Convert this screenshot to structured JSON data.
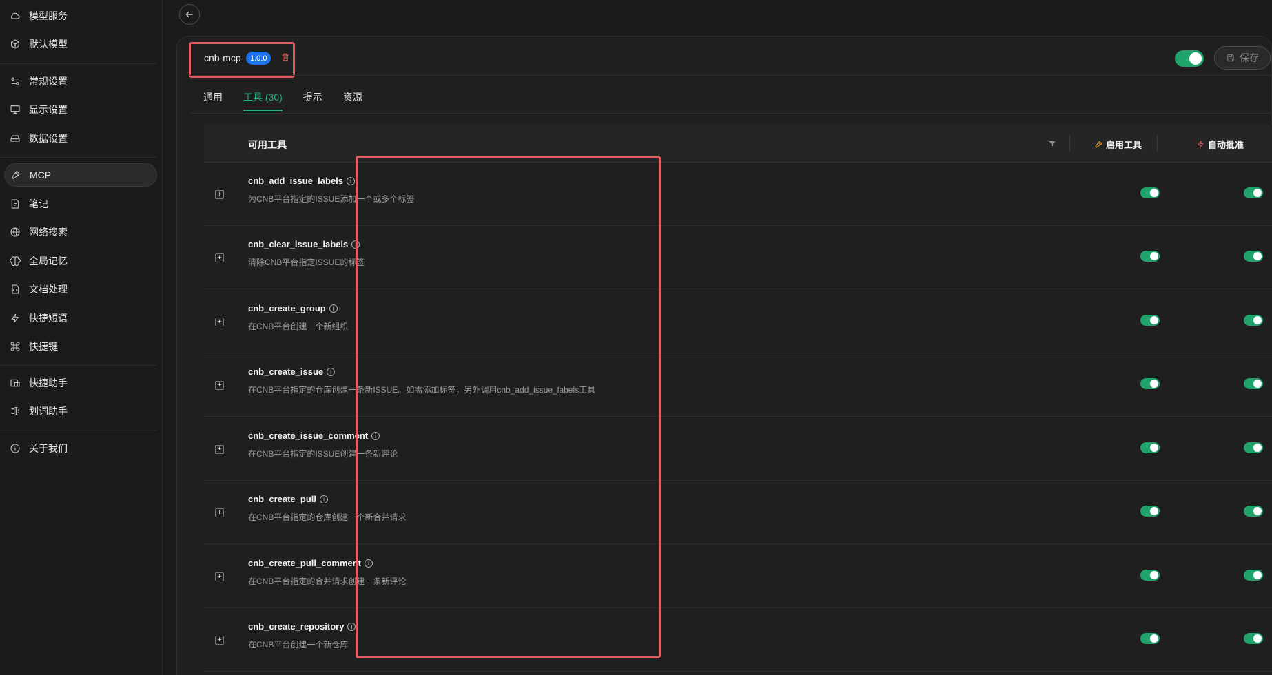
{
  "sidebar": {
    "items": [
      {
        "label": "模型服务",
        "icon": "cloud-icon"
      },
      {
        "label": "默认模型",
        "icon": "cube-icon"
      },
      {
        "label": "常规设置",
        "icon": "sliders-icon"
      },
      {
        "label": "显示设置",
        "icon": "monitor-icon"
      },
      {
        "label": "数据设置",
        "icon": "database-icon"
      },
      {
        "label": "MCP",
        "icon": "hammer-icon",
        "active": true
      },
      {
        "label": "笔记",
        "icon": "note-icon"
      },
      {
        "label": "网络搜索",
        "icon": "globe-icon"
      },
      {
        "label": "全局记忆",
        "icon": "brain-icon"
      },
      {
        "label": "文档处理",
        "icon": "doc-code-icon"
      },
      {
        "label": "快捷短语",
        "icon": "zap-icon"
      },
      {
        "label": "快捷键",
        "icon": "command-icon"
      },
      {
        "label": "快捷助手",
        "icon": "assistant-icon"
      },
      {
        "label": "划词助手",
        "icon": "text-select-icon"
      },
      {
        "label": "关于我们",
        "icon": "info-icon"
      }
    ]
  },
  "server": {
    "name": "cnb-mcp",
    "version": "1.0.0",
    "enabled": true,
    "save_label": "保存"
  },
  "tabs": [
    {
      "label": "通用",
      "active": false
    },
    {
      "label": "工具 (30)",
      "active": true
    },
    {
      "label": "提示",
      "active": false
    },
    {
      "label": "资源",
      "active": false
    }
  ],
  "table": {
    "col_name": "可用工具",
    "col_enable": "启用工具",
    "col_auto": "自动批准",
    "rows": [
      {
        "name": "cnb_add_issue_labels",
        "desc": "为CNB平台指定的ISSUE添加一个或多个标签",
        "enabled": true,
        "auto": true
      },
      {
        "name": "cnb_clear_issue_labels",
        "desc": "清除CNB平台指定ISSUE的标签",
        "enabled": true,
        "auto": true
      },
      {
        "name": "cnb_create_group",
        "desc": "在CNB平台创建一个新组织",
        "enabled": true,
        "auto": true
      },
      {
        "name": "cnb_create_issue",
        "desc": "在CNB平台指定的仓库创建一条新ISSUE。如需添加标签，另外调用cnb_add_issue_labels工具",
        "enabled": true,
        "auto": true
      },
      {
        "name": "cnb_create_issue_comment",
        "desc": "在CNB平台指定的ISSUE创建一条新评论",
        "enabled": true,
        "auto": true
      },
      {
        "name": "cnb_create_pull",
        "desc": "在CNB平台指定的仓库创建一个新合并请求",
        "enabled": true,
        "auto": true
      },
      {
        "name": "cnb_create_pull_comment",
        "desc": "在CNB平台指定的合并请求创建一条新评论",
        "enabled": true,
        "auto": true
      },
      {
        "name": "cnb_create_repository",
        "desc": "在CNB平台创建一个新仓库",
        "enabled": true,
        "auto": true
      }
    ]
  },
  "colors": {
    "accent": "#1fa36b",
    "badge": "#1a73e8",
    "danger": "#e05b60",
    "enable_icon": "#f0a020"
  }
}
